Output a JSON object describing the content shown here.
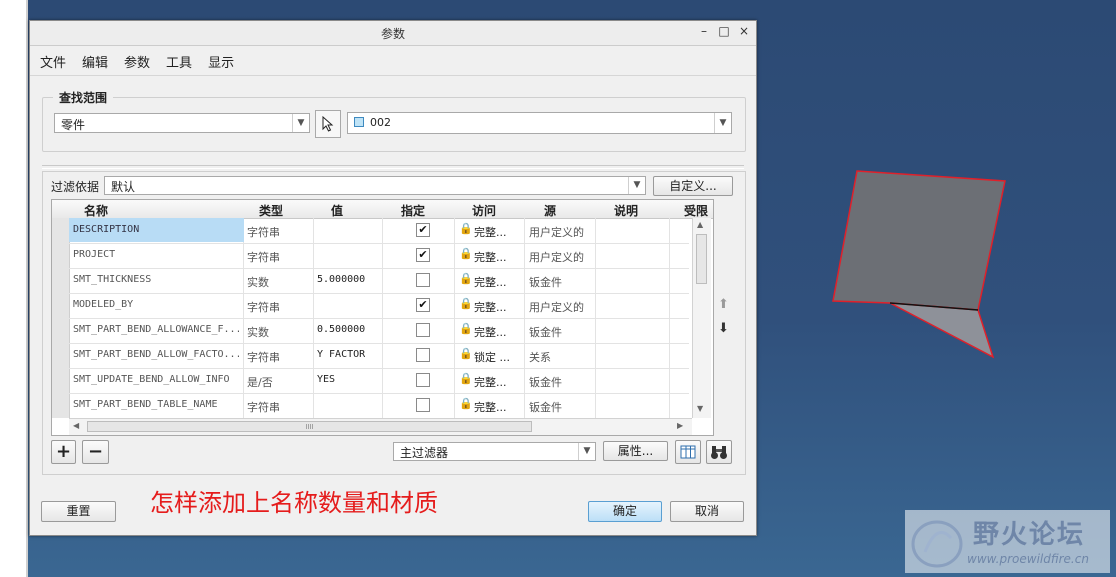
{
  "dialog": {
    "title": "参数"
  },
  "window_buttons": {
    "minimize": "–",
    "maximize": "□",
    "close": "×"
  },
  "menu": [
    "文件",
    "编辑",
    "参数",
    "工具",
    "显示"
  ],
  "scope": {
    "label": "查找范围",
    "type_value": "零件",
    "object_value": "002"
  },
  "filter": {
    "label": "过滤依据",
    "value": "默认",
    "customize_button": "自定义..."
  },
  "table": {
    "headers": [
      "名称",
      "类型",
      "值",
      "指定",
      "访问",
      "源",
      "说明",
      "受限"
    ],
    "rows": [
      {
        "name": "DESCRIPTION",
        "type": "字符串",
        "value": "",
        "designated": true,
        "access": "完整...",
        "source": "用户定义的",
        "desc": ""
      },
      {
        "name": "PROJECT",
        "type": "字符串",
        "value": "",
        "designated": true,
        "access": "完整...",
        "source": "用户定义的",
        "desc": ""
      },
      {
        "name": "SMT_THICKNESS",
        "type": "实数",
        "value": "5.000000",
        "designated": false,
        "access": "完整...",
        "source": "钣金件",
        "desc": ""
      },
      {
        "name": "MODELED_BY",
        "type": "字符串",
        "value": "",
        "designated": true,
        "access": "完整...",
        "source": "用户定义的",
        "desc": ""
      },
      {
        "name": "SMT_PART_BEND_ALLOWANCE_F...",
        "type": "实数",
        "value": "0.500000",
        "designated": false,
        "access": "完整...",
        "source": "钣金件",
        "desc": ""
      },
      {
        "name": "SMT_PART_BEND_ALLOW_FACTO...",
        "type": "字符串",
        "value": "Y FACTOR",
        "designated": false,
        "access": "锁定 ...",
        "source": "关系",
        "desc": ""
      },
      {
        "name": "SMT_UPDATE_BEND_ALLOW_INFO",
        "type": "是/否",
        "value": "YES",
        "designated": false,
        "access": "完整...",
        "source": "钣金件",
        "desc": ""
      },
      {
        "name": "SMT_PART_BEND_TABLE_NAME",
        "type": "字符串",
        "value": "",
        "designated": false,
        "access": "完整...",
        "source": "钣金件",
        "desc": ""
      }
    ],
    "hscroll_grip": "IIII"
  },
  "bottom": {
    "main_filter": "主过滤器",
    "properties_button": "属性..."
  },
  "footer": {
    "reset_button": "重置",
    "ok_button": "确定",
    "cancel_button": "取消"
  },
  "annotation": "怎样添加上名称数量和材质",
  "watermark": {
    "title": "野火论坛",
    "url": "www.proewildfire.cn"
  },
  "colors": {
    "accent_selection": "#b8dcf5",
    "annotation_red": "#e51c1c",
    "viewport_bg": "#30507c",
    "model_face": "#6c6f75",
    "model_edge": "#e0202a"
  }
}
